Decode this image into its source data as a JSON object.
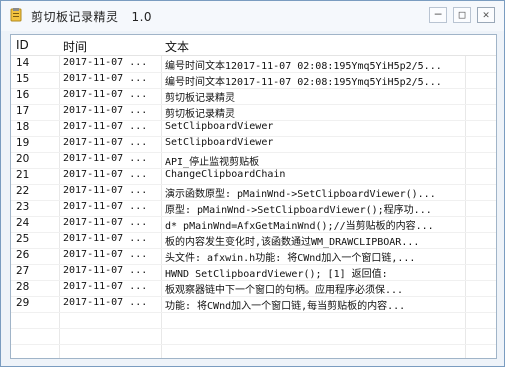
{
  "window": {
    "title": "剪切板记录精灵   1.0"
  },
  "titlebar_buttons": {
    "minimize": "─",
    "maximize": "□",
    "close": "✕"
  },
  "table": {
    "columns": [
      "ID",
      "时间",
      "文本"
    ],
    "rows": [
      {
        "id": "14",
        "time": "2017-11-07 ...",
        "text": "编号时间文本12017-11-07 02:08:195Ymq5YiH5p2/5..."
      },
      {
        "id": "15",
        "time": "2017-11-07 ...",
        "text": "编号时间文本12017-11-07 02:08:195Ymq5YiH5p2/5..."
      },
      {
        "id": "16",
        "time": "2017-11-07 ...",
        "text": "剪切板记录精灵"
      },
      {
        "id": "17",
        "time": "2017-11-07 ...",
        "text": "剪切板记录精灵"
      },
      {
        "id": "18",
        "time": "2017-11-07 ...",
        "text": "SetClipboardViewer"
      },
      {
        "id": "19",
        "time": "2017-11-07 ...",
        "text": "SetClipboardViewer"
      },
      {
        "id": "20",
        "time": "2017-11-07 ...",
        "text": "API_停止监视剪贴板"
      },
      {
        "id": "21",
        "time": "2017-11-07 ...",
        "text": "ChangeClipboardChain"
      },
      {
        "id": "22",
        "time": "2017-11-07 ...",
        "text": "演示函数原型:  pMainWnd->SetClipboardViewer()..."
      },
      {
        "id": "23",
        "time": "2017-11-07 ...",
        "text": "原型:  pMainWnd->SetClipboardViewer();程序功..."
      },
      {
        "id": "24",
        "time": "2017-11-07 ...",
        "text": "d* pMainWnd=AfxGetMainWnd();//当剪贴板的内容..."
      },
      {
        "id": "25",
        "time": "2017-11-07 ...",
        "text": "板的内容发生变化时,该函数通过WM_DRAWCLIPBOAR..."
      },
      {
        "id": "26",
        "time": "2017-11-07 ...",
        "text": "头文件:  afxwin.h功能: 将CWnd加入一个窗口链,..."
      },
      {
        "id": "27",
        "time": "2017-11-07 ...",
        "text": "HWND SetClipboardViewer();  [1] 返回值:"
      },
      {
        "id": "28",
        "time": "2017-11-07 ...",
        "text": "板观察器链中下一个窗口的句柄。应用程序必须保..."
      },
      {
        "id": "29",
        "time": "2017-11-07 ...",
        "text": "功能: 将CWnd加入一个窗口链,每当剪贴板的内容..."
      }
    ]
  },
  "colors": {
    "accent": "#2f7fd8",
    "border": "#a0b4c8"
  }
}
